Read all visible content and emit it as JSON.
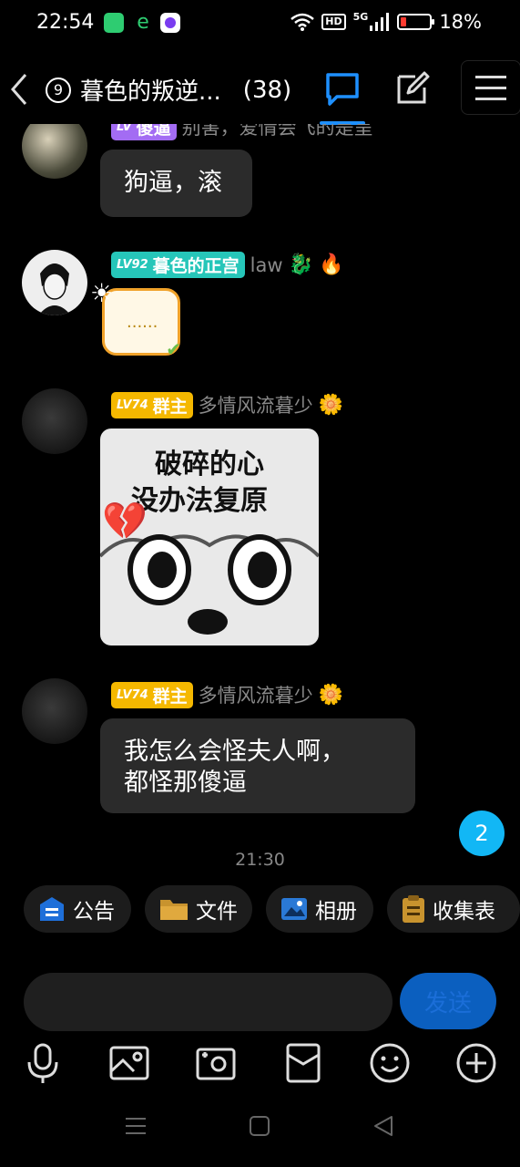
{
  "status_bar": {
    "time": "22:54",
    "network": "5G",
    "hd": "HD",
    "battery_text": "18%",
    "battery_level": 0.18
  },
  "header": {
    "unread_circle": "9",
    "title": "暮色的叛逆...",
    "member_count": "(38)"
  },
  "messages": [
    {
      "badge_lv": "LV",
      "badge_title": "傻逼",
      "extra": "别害，爱情会飞的是呈",
      "text": "狗逼，滚"
    },
    {
      "badge_lv": "LV92",
      "badge_title": "暮色的正宫",
      "name": "law",
      "text": "......"
    },
    {
      "badge_lv": "LV74",
      "badge_title": "群主",
      "name": "多情风流暮少",
      "sticker_line1": "破碎的心",
      "sticker_line2": "没办法复原"
    },
    {
      "badge_lv": "LV74",
      "badge_title": "群主",
      "name": "多情风流暮少",
      "text_line1": "我怎么会怪夫人啊，",
      "text_line2": "都怪那傻逼"
    }
  ],
  "timestamp": "21:30",
  "unread_count": "2",
  "shortcuts": [
    {
      "label": "公告",
      "icon": "announcement-icon"
    },
    {
      "label": "文件",
      "icon": "folder-icon"
    },
    {
      "label": "相册",
      "icon": "album-icon"
    },
    {
      "label": "收集表",
      "icon": "clipboard-icon"
    }
  ],
  "input": {
    "placeholder": "",
    "send_label": "发送"
  },
  "colors": {
    "accent": "#1e90ff",
    "unread": "#12b7f5",
    "badge_teal": "#26c6b9",
    "badge_yellow": "#f5b800",
    "badge_purple": "#a36cf3"
  }
}
